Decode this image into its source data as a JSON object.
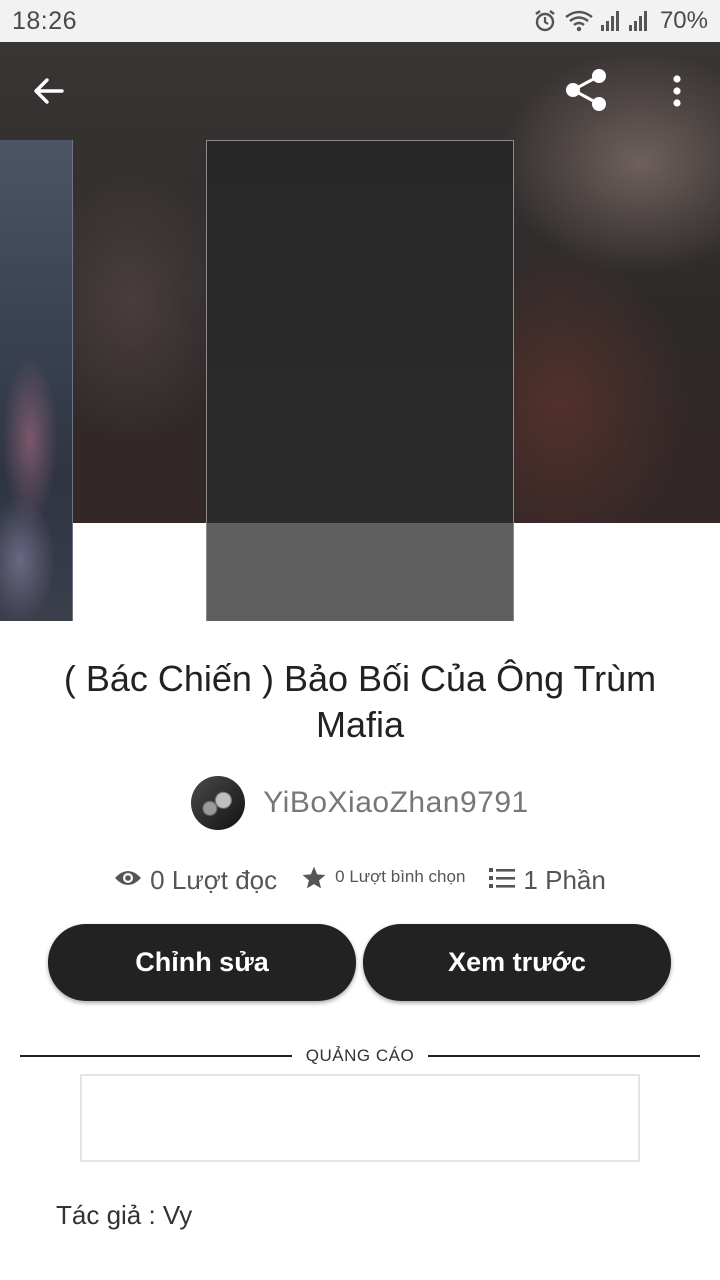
{
  "status_bar": {
    "time": "18:26",
    "battery": "70%",
    "icons": [
      "alarm-icon",
      "wifi-icon",
      "signal-icon",
      "signal-icon"
    ]
  },
  "toolbar": {
    "back_icon": "arrow-left-icon",
    "share_icon": "share-icon",
    "more_icon": "more-vertical-icon"
  },
  "story": {
    "title": "( Bác Chiến ) Bảo Bối Của Ông Trùm Mafia",
    "author": "YiBoXiaoZhan9791",
    "stats": {
      "reads": "0 Lượt đọc",
      "votes": "0 Lượt bình chọn",
      "parts": "1 Phần"
    }
  },
  "actions": {
    "edit_label": "Chỉnh sửa",
    "preview_label": "Xem trước"
  },
  "ad": {
    "label": "QUẢNG CÁO"
  },
  "description": {
    "text": "Tác giả : Vy"
  },
  "colors": {
    "primary_button": "#222222",
    "hero_background": "#2e2a2a"
  }
}
